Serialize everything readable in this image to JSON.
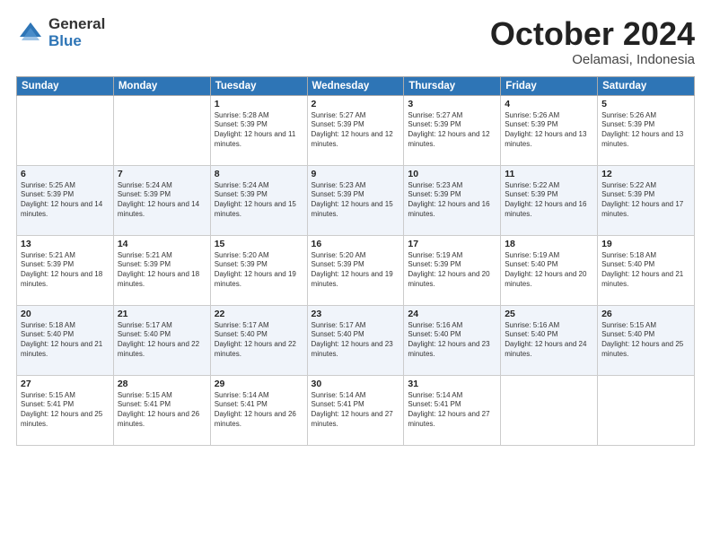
{
  "header": {
    "logo_general": "General",
    "logo_blue": "Blue",
    "month_title": "October 2024",
    "location": "Oelamasi, Indonesia"
  },
  "weekdays": [
    "Sunday",
    "Monday",
    "Tuesday",
    "Wednesday",
    "Thursday",
    "Friday",
    "Saturday"
  ],
  "weeks": [
    [
      {
        "day": "",
        "info": ""
      },
      {
        "day": "",
        "info": ""
      },
      {
        "day": "1",
        "info": "Sunrise: 5:28 AM\nSunset: 5:39 PM\nDaylight: 12 hours and 11 minutes."
      },
      {
        "day": "2",
        "info": "Sunrise: 5:27 AM\nSunset: 5:39 PM\nDaylight: 12 hours and 12 minutes."
      },
      {
        "day": "3",
        "info": "Sunrise: 5:27 AM\nSunset: 5:39 PM\nDaylight: 12 hours and 12 minutes."
      },
      {
        "day": "4",
        "info": "Sunrise: 5:26 AM\nSunset: 5:39 PM\nDaylight: 12 hours and 13 minutes."
      },
      {
        "day": "5",
        "info": "Sunrise: 5:26 AM\nSunset: 5:39 PM\nDaylight: 12 hours and 13 minutes."
      }
    ],
    [
      {
        "day": "6",
        "info": "Sunrise: 5:25 AM\nSunset: 5:39 PM\nDaylight: 12 hours and 14 minutes."
      },
      {
        "day": "7",
        "info": "Sunrise: 5:24 AM\nSunset: 5:39 PM\nDaylight: 12 hours and 14 minutes."
      },
      {
        "day": "8",
        "info": "Sunrise: 5:24 AM\nSunset: 5:39 PM\nDaylight: 12 hours and 15 minutes."
      },
      {
        "day": "9",
        "info": "Sunrise: 5:23 AM\nSunset: 5:39 PM\nDaylight: 12 hours and 15 minutes."
      },
      {
        "day": "10",
        "info": "Sunrise: 5:23 AM\nSunset: 5:39 PM\nDaylight: 12 hours and 16 minutes."
      },
      {
        "day": "11",
        "info": "Sunrise: 5:22 AM\nSunset: 5:39 PM\nDaylight: 12 hours and 16 minutes."
      },
      {
        "day": "12",
        "info": "Sunrise: 5:22 AM\nSunset: 5:39 PM\nDaylight: 12 hours and 17 minutes."
      }
    ],
    [
      {
        "day": "13",
        "info": "Sunrise: 5:21 AM\nSunset: 5:39 PM\nDaylight: 12 hours and 18 minutes."
      },
      {
        "day": "14",
        "info": "Sunrise: 5:21 AM\nSunset: 5:39 PM\nDaylight: 12 hours and 18 minutes."
      },
      {
        "day": "15",
        "info": "Sunrise: 5:20 AM\nSunset: 5:39 PM\nDaylight: 12 hours and 19 minutes."
      },
      {
        "day": "16",
        "info": "Sunrise: 5:20 AM\nSunset: 5:39 PM\nDaylight: 12 hours and 19 minutes."
      },
      {
        "day": "17",
        "info": "Sunrise: 5:19 AM\nSunset: 5:39 PM\nDaylight: 12 hours and 20 minutes."
      },
      {
        "day": "18",
        "info": "Sunrise: 5:19 AM\nSunset: 5:40 PM\nDaylight: 12 hours and 20 minutes."
      },
      {
        "day": "19",
        "info": "Sunrise: 5:18 AM\nSunset: 5:40 PM\nDaylight: 12 hours and 21 minutes."
      }
    ],
    [
      {
        "day": "20",
        "info": "Sunrise: 5:18 AM\nSunset: 5:40 PM\nDaylight: 12 hours and 21 minutes."
      },
      {
        "day": "21",
        "info": "Sunrise: 5:17 AM\nSunset: 5:40 PM\nDaylight: 12 hours and 22 minutes."
      },
      {
        "day": "22",
        "info": "Sunrise: 5:17 AM\nSunset: 5:40 PM\nDaylight: 12 hours and 22 minutes."
      },
      {
        "day": "23",
        "info": "Sunrise: 5:17 AM\nSunset: 5:40 PM\nDaylight: 12 hours and 23 minutes."
      },
      {
        "day": "24",
        "info": "Sunrise: 5:16 AM\nSunset: 5:40 PM\nDaylight: 12 hours and 23 minutes."
      },
      {
        "day": "25",
        "info": "Sunrise: 5:16 AM\nSunset: 5:40 PM\nDaylight: 12 hours and 24 minutes."
      },
      {
        "day": "26",
        "info": "Sunrise: 5:15 AM\nSunset: 5:40 PM\nDaylight: 12 hours and 25 minutes."
      }
    ],
    [
      {
        "day": "27",
        "info": "Sunrise: 5:15 AM\nSunset: 5:41 PM\nDaylight: 12 hours and 25 minutes."
      },
      {
        "day": "28",
        "info": "Sunrise: 5:15 AM\nSunset: 5:41 PM\nDaylight: 12 hours and 26 minutes."
      },
      {
        "day": "29",
        "info": "Sunrise: 5:14 AM\nSunset: 5:41 PM\nDaylight: 12 hours and 26 minutes."
      },
      {
        "day": "30",
        "info": "Sunrise: 5:14 AM\nSunset: 5:41 PM\nDaylight: 12 hours and 27 minutes."
      },
      {
        "day": "31",
        "info": "Sunrise: 5:14 AM\nSunset: 5:41 PM\nDaylight: 12 hours and 27 minutes."
      },
      {
        "day": "",
        "info": ""
      },
      {
        "day": "",
        "info": ""
      }
    ]
  ]
}
